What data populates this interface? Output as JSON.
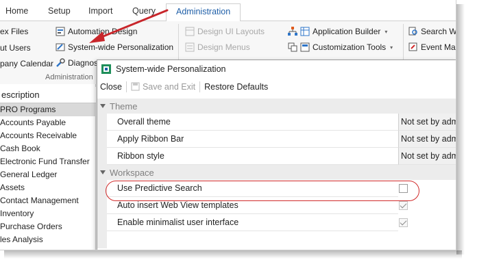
{
  "tabs": [
    "Home",
    "Setup",
    "Import",
    "Query",
    "Administration"
  ],
  "ribbon": {
    "left_items": [
      "ex Files",
      "ut Users",
      "pany Calendar"
    ],
    "col2_items": [
      "Automation Design",
      "System-wide Personalization",
      "Diagnos"
    ],
    "col3_items": [
      "Design UI Layouts",
      "Design Menus"
    ],
    "col4_items": [
      "Application Builder",
      "Customization Tools"
    ],
    "col5_items": [
      "Search Wi",
      "Event Ma"
    ],
    "group_label": "Administration"
  },
  "left_list": {
    "header": "escription",
    "items": [
      "PRO Programs",
      "Accounts Payable",
      "Accounts Receivable",
      "Cash Book",
      "Electronic Fund Transfer",
      "General Ledger",
      "Assets",
      "Contact Management",
      "Inventory",
      "Purchase Orders",
      "les Analysis"
    ]
  },
  "dialog": {
    "title": "System-wide Personalization",
    "toolbar": {
      "close": "Close",
      "save_exit": "Save and Exit",
      "restore": "Restore Defaults"
    },
    "theme": {
      "label": "Theme",
      "rows": [
        {
          "name": "Overall theme",
          "value": "Not set by adm"
        },
        {
          "name": "Apply Ribbon Bar",
          "value": "Not set by adm"
        },
        {
          "name": "Ribbon style",
          "value": "Not set by adm"
        }
      ]
    },
    "workspace": {
      "label": "Workspace",
      "rows": [
        {
          "name": "Use Predictive Search",
          "checked": false
        },
        {
          "name": "Auto insert Web View templates",
          "checked": true
        },
        {
          "name": "Enable minimalist user interface",
          "checked": true
        }
      ]
    }
  },
  "colors": {
    "accent": "#1f5fa8",
    "annotation": "#d12a2a"
  }
}
